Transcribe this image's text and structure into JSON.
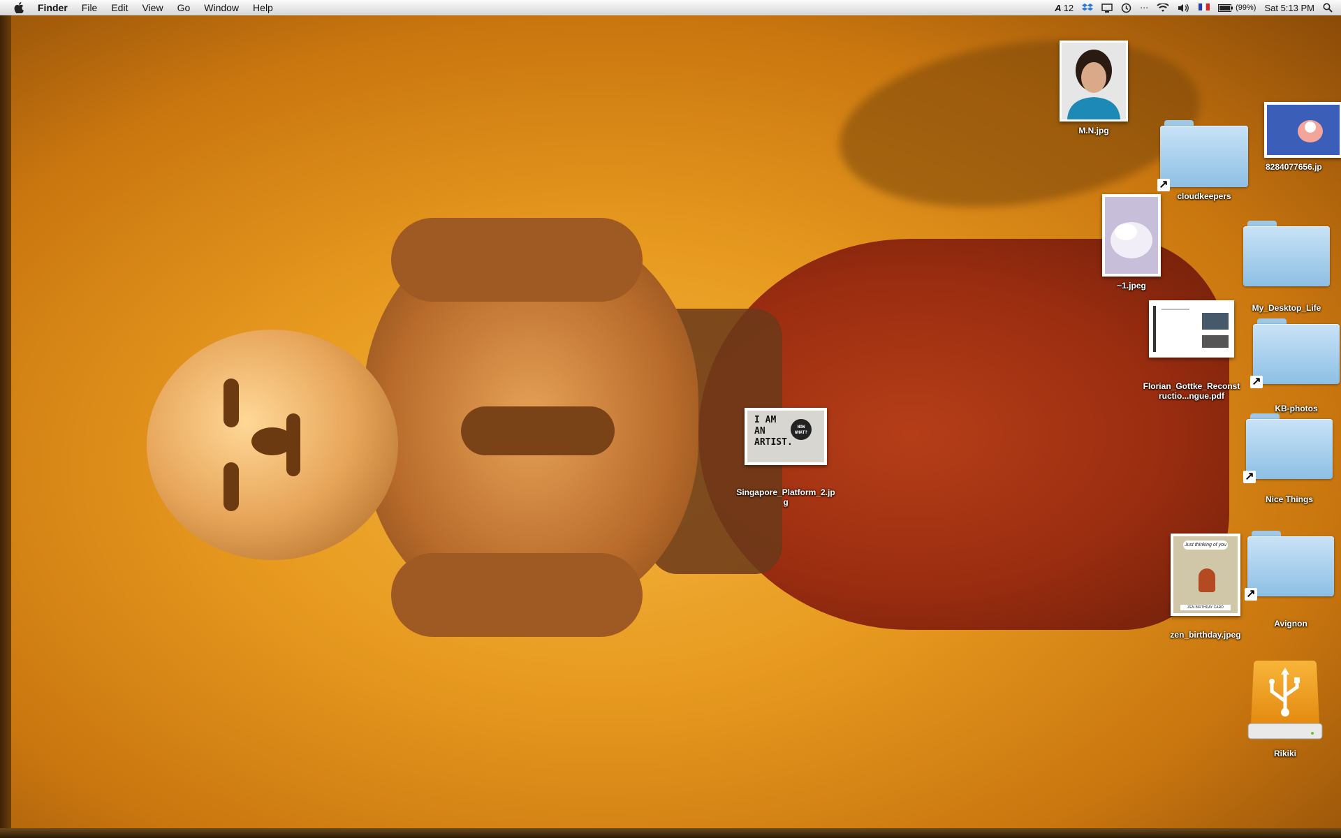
{
  "menubar": {
    "app_name": "Finder",
    "menus": [
      "File",
      "Edit",
      "View",
      "Go",
      "Window",
      "Help"
    ],
    "status": {
      "font_count": "12",
      "battery": "(99%)",
      "clock": "Sat 5:13 PM"
    }
  },
  "desktop": {
    "icons": [
      {
        "label": "M.N.jpg"
      },
      {
        "label": "8284077656.jp"
      },
      {
        "label": "cloudkeepers"
      },
      {
        "label": "~1.jpeg"
      },
      {
        "label": "My_Desktop_Life"
      },
      {
        "label": "Florian_Gottke_Reconstructio...ngue.pdf"
      },
      {
        "label": "KB-photos"
      },
      {
        "label": "Singapore_Platform_2.jpg"
      },
      {
        "label": "Nice Things"
      },
      {
        "label": "zen_birthday.jpeg"
      },
      {
        "label": "Avignon"
      },
      {
        "label": "Rikiki"
      }
    ],
    "artist_card": {
      "line1": "I AM",
      "line2": "AN",
      "line3": "ARTIST.",
      "bubble": "NOW WHAT?"
    },
    "zen_card": {
      "bubble": "Just thinking of you",
      "caption": "ZEN BIRTHDAY CARD"
    }
  },
  "colors": {
    "folder": "#a9d0ee",
    "wallpaper": "#e79a1f",
    "usb_drive": "#f4a623"
  }
}
